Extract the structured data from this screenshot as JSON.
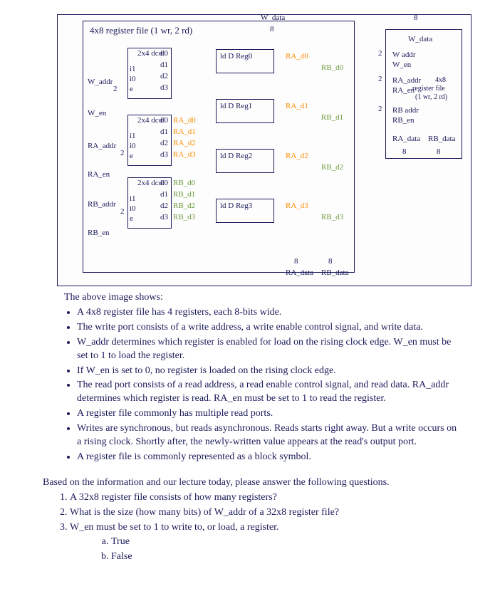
{
  "diagram": {
    "title": "4x8 register file (1 wr, 2 rd)",
    "top_signal": "W_data",
    "bus_width": "8",
    "left_ports": [
      "W_addr",
      "W_en",
      "RA_addr",
      "RA_en",
      "RB_addr",
      "RB_en"
    ],
    "addr_width": "2",
    "decoders": [
      {
        "name": "2x4 dcd",
        "inputs": [
          "i1",
          "i0",
          "e"
        ],
        "outputs": [
          "d0",
          "d1",
          "d2",
          "d3"
        ]
      },
      {
        "name": "2x4 dcd",
        "inputs": [
          "i1",
          "i0",
          "e"
        ],
        "outputs": [
          "d0",
          "d1",
          "d2",
          "d3"
        ],
        "out_labels": [
          "RA_d0",
          "RA_d1",
          "RA_d2",
          "RA_d3"
        ]
      },
      {
        "name": "2x4 dcd",
        "inputs": [
          "i1",
          "i0",
          "e"
        ],
        "outputs": [
          "d0",
          "d1",
          "d2",
          "d3"
        ],
        "out_labels": [
          "RB_d0",
          "RB_d1",
          "RB_d2",
          "RB_d3"
        ]
      }
    ],
    "registers": [
      {
        "label": "ld  D  Reg0",
        "ra": "RA_d0",
        "rb": "RB_d0"
      },
      {
        "label": "ld  D  Reg1",
        "ra": "RA_d1",
        "rb": "RB_d1"
      },
      {
        "label": "ld  D  Reg2",
        "ra": "RA_d2",
        "rb": "RB_d2"
      },
      {
        "label": "ld  D  Reg3",
        "ra": "RA_d3",
        "rb": "RB_d3"
      }
    ],
    "bottom_outputs": [
      "RA_data",
      "RB_data"
    ],
    "block_symbol": {
      "top": "W_data",
      "bus_top": "8",
      "inputs": [
        {
          "label": "W addr",
          "width": "2"
        },
        {
          "label": "W_en"
        },
        {
          "label": "RA_addr",
          "width": "2"
        },
        {
          "label": "RA_en"
        },
        {
          "label": "RB addr",
          "width": "2"
        },
        {
          "label": "RB_en"
        }
      ],
      "center": "4x8 register file (1 wr, 2 rd)",
      "outputs": [
        "RA_data",
        "RB_data"
      ],
      "out_bus": "8"
    }
  },
  "intro": "The above image shows:",
  "bullets": [
    "A 4x8 register file has 4 registers, each 8-bits wide.",
    "The write port consists of a write address, a write enable control signal, and write data.",
    "W_addr determines which register is enabled for load on the rising clock edge. W_en must be set to 1 to load the register.",
    "If W_en is set to 0, no register is loaded on the rising clock edge.",
    "The read port consists of a read address, a read enable control signal, and read data. RA_addr determines which register is read. RA_en must be set to 1 to read the register.",
    "A register file commonly has multiple read ports.",
    "Writes are synchronous, but reads asynchronous. Reads starts right away. But a write occurs on a rising clock. Shortly after, the newly-written value appears at the read's output port.",
    "A register file is commonly represented as a block symbol."
  ],
  "questions_intro": "Based on the information and our lecture today, please answer the following questions.",
  "questions": [
    "A 32x8 register file consists of how many registers?",
    "What is the size (how many bits) of W_addr of a 32x8 register file?",
    "W_en must be set to 1 to write to, or load, a register."
  ],
  "q3_options": [
    "True",
    "False"
  ]
}
